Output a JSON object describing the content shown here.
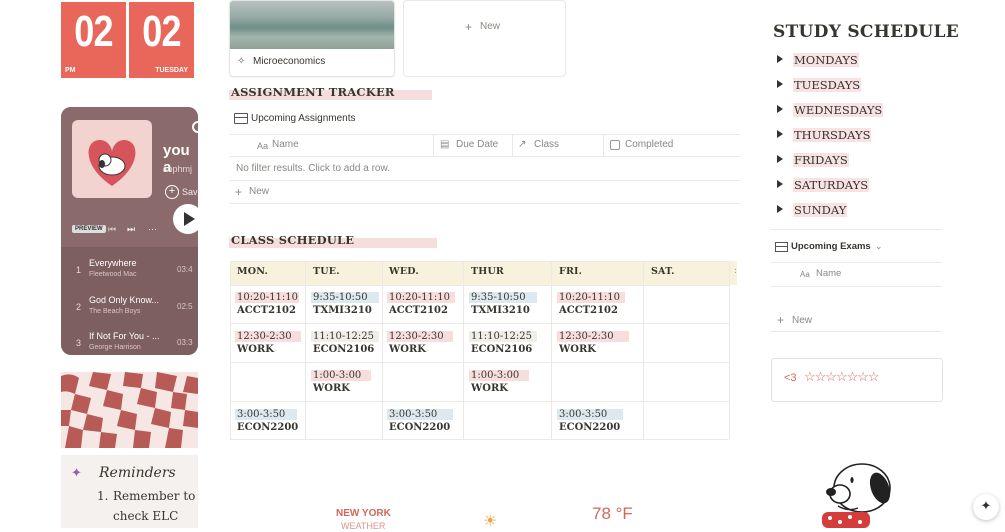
{
  "clock": {
    "hour": "02",
    "minute": "02",
    "ampm": "PM",
    "day": "TUESDAY"
  },
  "player": {
    "title": "you a",
    "artist": "sophmj",
    "save": "Sav",
    "preview": "PREVIEW",
    "tracks": [
      {
        "num": "1",
        "title": "Everywhere",
        "artist": "Fleetwood Mac",
        "dur": "03:4"
      },
      {
        "num": "2",
        "title": "God Only Know...",
        "artist": "The Beach Boys",
        "dur": "02:5"
      },
      {
        "num": "3",
        "title": "If Not For You - ...",
        "artist": "George Harrison",
        "dur": "03:3"
      }
    ]
  },
  "reminders": {
    "title": "Reminders",
    "item1_num": "1.",
    "item1_line1": "Remember to",
    "item1_line2": "check ELC"
  },
  "gallery": {
    "card_title": "Microeconomics",
    "new_label": "New"
  },
  "assignments": {
    "heading": "ASSIGNMENT TRACKER",
    "view": "Upcoming Assignments",
    "columns": {
      "name": "Name",
      "due": "Due Date",
      "class": "Class",
      "completed": "Completed"
    },
    "empty": "No filter results. Click to add a row.",
    "new": "New"
  },
  "class_schedule": {
    "heading": "CLASS SCHEDULE",
    "days": [
      "MON.",
      "TUE.",
      "WED.",
      "THUR",
      "FRI.",
      "SAT."
    ],
    "rows": [
      [
        {
          "time": "10:20-11:10",
          "code": "ACCT2102"
        },
        {
          "time": "9:35-10:50",
          "code": "TXMI3210"
        },
        {
          "time": "10:20-11:10",
          "code": "ACCT2102"
        },
        {
          "time": "9:35-10:50",
          "code": "TXMI3210"
        },
        {
          "time": "10:20-11:10",
          "code": "ACCT2102"
        }
      ],
      [
        {
          "time": "12:30-2:30",
          "code": "WORK"
        },
        {
          "time": "11:10-12:25",
          "code": "ECON2106"
        },
        {
          "time": "12:30-2:30",
          "code": "WORK"
        },
        {
          "time": "11:10-12:25",
          "code": "ECON2106"
        },
        {
          "time": "12:30-2:30",
          "code": "WORK"
        }
      ],
      [
        {
          "time": "1:00-3:00",
          "code": "WORK"
        },
        {
          "time": "1:00-3:00",
          "code": "WORK"
        }
      ],
      [
        {
          "time": "3:00-3:50",
          "code": "ECON2200"
        },
        {
          "time": "3:00-3:50",
          "code": "ECON2200"
        },
        {
          "time": "3:00-3:50",
          "code": "ECON2200"
        }
      ]
    ]
  },
  "weather": {
    "city": "NEW YORK",
    "label": "WEATHER",
    "temp": "78 °F"
  },
  "study": {
    "heading": "STUDY SCHEDULE",
    "days": [
      "MONDAYS",
      "TUESDAYS",
      "WEDNESDAYS",
      "THURSDAYS",
      "FRIDAYS",
      "SATURDAYS",
      "SUNDAY"
    ]
  },
  "exams": {
    "view": "Upcoming Exams",
    "name": "Name",
    "new": "New"
  },
  "rating": {
    "heart": "<3",
    "stars": "☆☆☆☆☆☆☆"
  },
  "colors": {
    "accent": "#e8665a",
    "highlight": "#f6dedd",
    "calendar_header": "#f8f1dc",
    "blue_tag": "#dde9ee"
  }
}
